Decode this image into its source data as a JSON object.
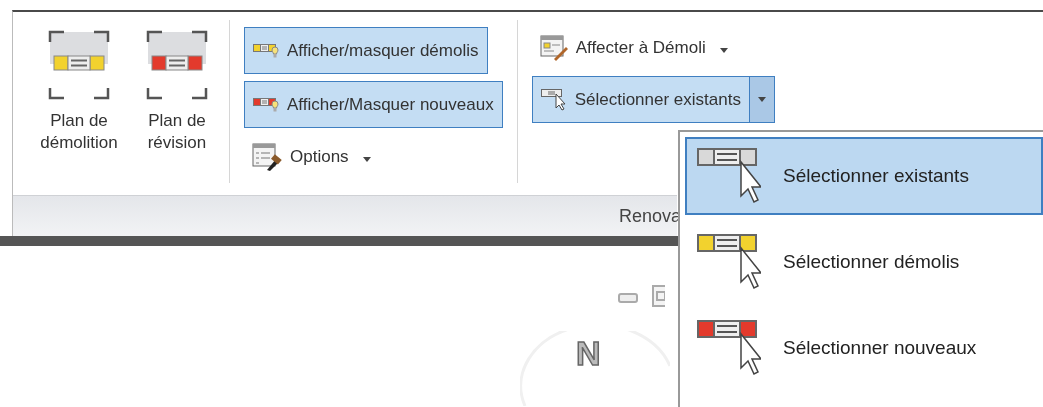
{
  "ribbon": {
    "large_buttons": [
      {
        "label": "Plan de démolition",
        "color": "#f2d22e"
      },
      {
        "label": "Plan de révision",
        "color": "#e33a2c"
      }
    ],
    "toggle_buttons": [
      {
        "label": "Afficher/masquer démolis",
        "on": true,
        "color": "#f2d22e"
      },
      {
        "label": "Afficher/Masquer nouveaux",
        "on": true,
        "color": "#e33a2c"
      }
    ],
    "options_button": {
      "label": "Options"
    },
    "assign_button": {
      "label": "Affecter à Démoli"
    },
    "select_button": {
      "label": "Sélectionner existants",
      "expanded": true
    },
    "panel_title": "Renova"
  },
  "dropdown": {
    "items": [
      {
        "label": "Sélectionner existants",
        "color": "#d9d9d9",
        "selected": true
      },
      {
        "label": "Sélectionner démolis",
        "color": "#f2d22e",
        "selected": false
      },
      {
        "label": "Sélectionner nouveaux",
        "color": "#e33a2c",
        "selected": false
      }
    ]
  },
  "viewcube": {
    "letter": "N"
  }
}
